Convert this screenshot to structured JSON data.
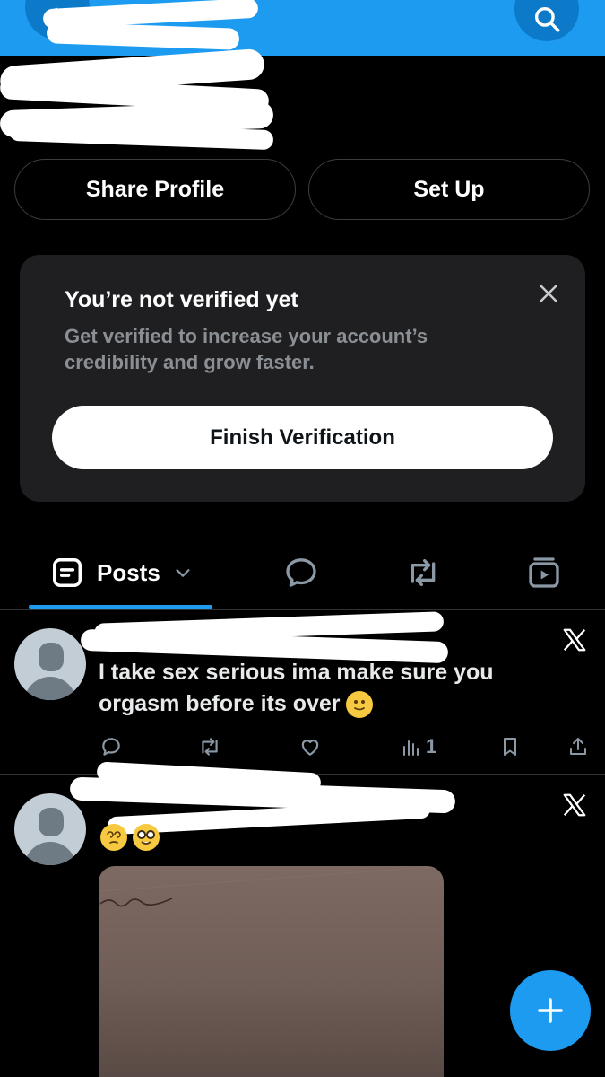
{
  "profile": {
    "share_label": "Share Profile",
    "setup_label": "Set Up"
  },
  "verify": {
    "title": "You’re not verified yet",
    "body": "Get verified to increase your account’s credibility and grow faster.",
    "button_label": "Finish Verification"
  },
  "tabs": {
    "posts_label": "Posts"
  },
  "posts": [
    {
      "text": "I take sex serious ima make sure you orgasm before its over",
      "views": "1"
    },
    {
      "text": ""
    }
  ],
  "colors": {
    "accent": "#1d9bf0",
    "background": "#000000",
    "card": "#1f1f21"
  }
}
